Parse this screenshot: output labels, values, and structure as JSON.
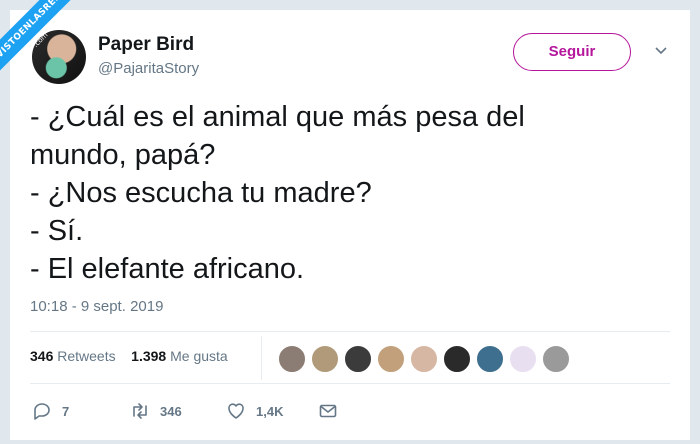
{
  "watermark": {
    "text": "VISTOENLASREDES",
    "sub": ".com"
  },
  "tweet": {
    "author_name": "Paper Bird",
    "author_handle": "@PajaritaStory",
    "follow_label": "Seguir",
    "lines": [
      "- ¿Cuál es el animal que más pesa del",
      "mundo, papá?",
      "- ¿Nos escucha tu madre?",
      "- Sí.",
      "- El elefante africano."
    ],
    "timestamp": "10:18 - 9 sept. 2019",
    "retweets_count": "346",
    "retweets_label": "Retweets",
    "likes_count": "1.398",
    "likes_label": "Me gusta",
    "replies": "7",
    "retweets_action": "346",
    "likes_action": "1,4K"
  },
  "colors": {
    "accent": "#b5169c",
    "muted": "#657786",
    "ribbon": "#1da1f2"
  },
  "icons": [
    "avatar",
    "chevron-down-icon",
    "reply-icon",
    "retweet-icon",
    "heart-icon",
    "mail-icon"
  ]
}
